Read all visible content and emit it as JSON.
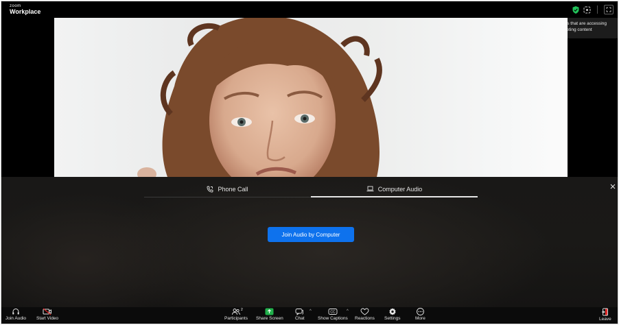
{
  "brand": {
    "small": "zoom",
    "name": "Workplace"
  },
  "tooltip": {
    "text": "See apps that are accessing your meeting content"
  },
  "audio_panel": {
    "tabs": [
      {
        "label": "Phone Call",
        "icon": "phone-icon",
        "active": false
      },
      {
        "label": "Computer Audio",
        "icon": "laptop-icon",
        "active": true
      }
    ],
    "join_button": "Join Audio by Computer"
  },
  "toolbar": {
    "join_audio": "Join Audio",
    "start_video": "Start Video",
    "participants": "Participants",
    "participants_count": "2",
    "share_screen": "Share Screen",
    "chat": "Chat",
    "show_captions": "Show Captions",
    "reactions": "Reactions",
    "settings": "Settings",
    "more": "More",
    "leave": "Leave"
  },
  "colors": {
    "accent": "#0e72ed",
    "share_green": "#21b04b",
    "leave_red": "#e02828",
    "shield_green": "#21c25a"
  }
}
